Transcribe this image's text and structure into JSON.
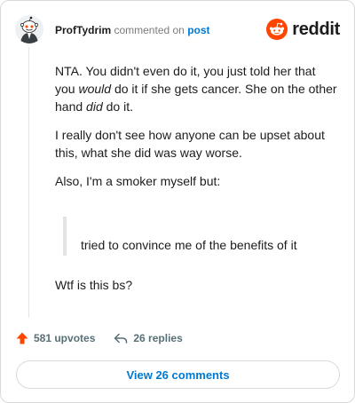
{
  "header": {
    "username": "ProfTydrim",
    "action_text": "commented on",
    "post_link": "post",
    "brand": "reddit"
  },
  "comment": {
    "para1": {
      "a": "NTA. You didn't even do it, you just told her that you ",
      "b": "would",
      "c": " do it if she gets cancer. She on the other hand ",
      "d": "did",
      "e": " do it."
    },
    "para2": "I really don't see how anyone can be upset about this, what she did was way worse.",
    "para3": "Also, I'm a smoker myself but:",
    "quote": "tried to convince me of the benefits of it",
    "para4": "Wtf is this bs?"
  },
  "actions": {
    "upvotes": "581 upvotes",
    "replies": "26 replies"
  },
  "view_comments_label": "View 26 comments",
  "colors": {
    "reddit_orange": "#ff4500",
    "link_blue": "#0079d3",
    "meta_gray": "#576f76"
  },
  "icons": [
    "avatar-icon",
    "reddit-logo-icon",
    "upvote-icon",
    "reply-icon"
  ]
}
